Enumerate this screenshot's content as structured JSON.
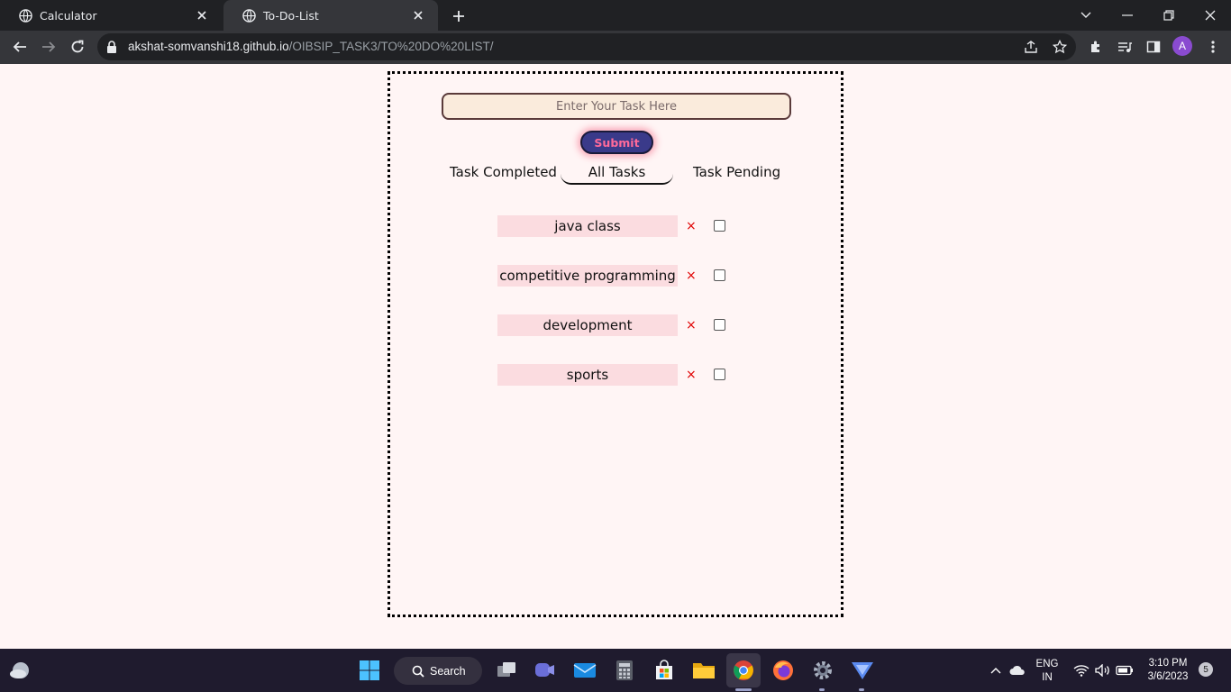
{
  "browser": {
    "tabs": [
      {
        "title": "Calculator"
      },
      {
        "title": "To-Do-List"
      }
    ],
    "url_host": "akshat-somvanshi18.github.io",
    "url_path": "/OIBSIP_TASK3/TO%20DO%20LIST/",
    "profile_initial": "A"
  },
  "todo": {
    "input_placeholder": "Enter Your Task Here",
    "submit_label": "Submit",
    "filters": {
      "completed": "Task Completed",
      "all": "All Tasks",
      "pending": "Task Pending"
    },
    "tasks": [
      {
        "text": "java class",
        "delete": "×",
        "done": false
      },
      {
        "text": "competitive programming",
        "delete": "×",
        "done": false
      },
      {
        "text": "development",
        "delete": "×",
        "done": false
      },
      {
        "text": "sports",
        "delete": "×",
        "done": false
      }
    ]
  },
  "taskbar": {
    "search_label": "Search",
    "lang_line1": "ENG",
    "lang_line2": "IN",
    "time": "3:10 PM",
    "date": "3/6/2023",
    "notification_count": "5"
  },
  "colors": {
    "page_bg": "#fff5f5",
    "task_bg": "#fbdce0",
    "submit_bg": "#3a3a8a",
    "submit_text": "#ff6a9a",
    "delete_x": "#e00000"
  }
}
